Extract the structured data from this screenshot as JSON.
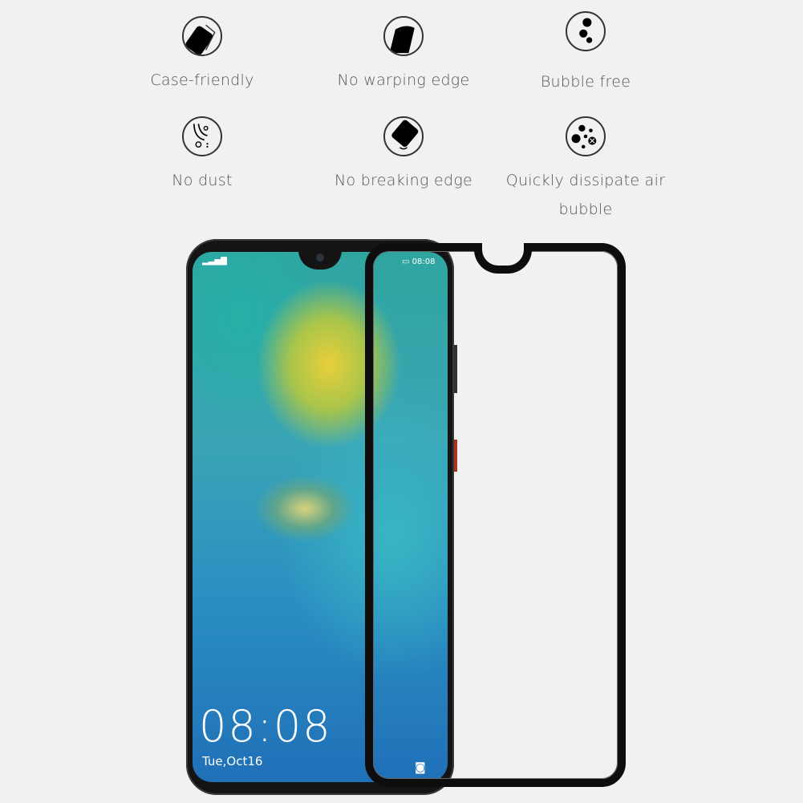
{
  "features": [
    {
      "icon": "case-friendly-icon",
      "label": "Case-friendly"
    },
    {
      "icon": "no-warping-edge-icon",
      "label": "No warping edge"
    },
    {
      "icon": "bubble-free-icon",
      "label": "Bubble free"
    },
    {
      "icon": "no-dust-icon",
      "label": "No dust"
    },
    {
      "icon": "no-breaking-edge-icon",
      "label": "No breaking edge"
    },
    {
      "icon": "dissipate-bubble-icon",
      "label": "Quickly dissipate air bubble"
    }
  ],
  "phone": {
    "clock": "08:08",
    "date": "Tue,Oct16",
    "signal_icon": "signal-icon"
  },
  "protector": {
    "status_time": "08:08",
    "battery_icon": "battery-icon",
    "camera_icon": "camera-icon"
  },
  "colors": {
    "frame": "#0d0d0d",
    "background": "#f1f1f1"
  }
}
